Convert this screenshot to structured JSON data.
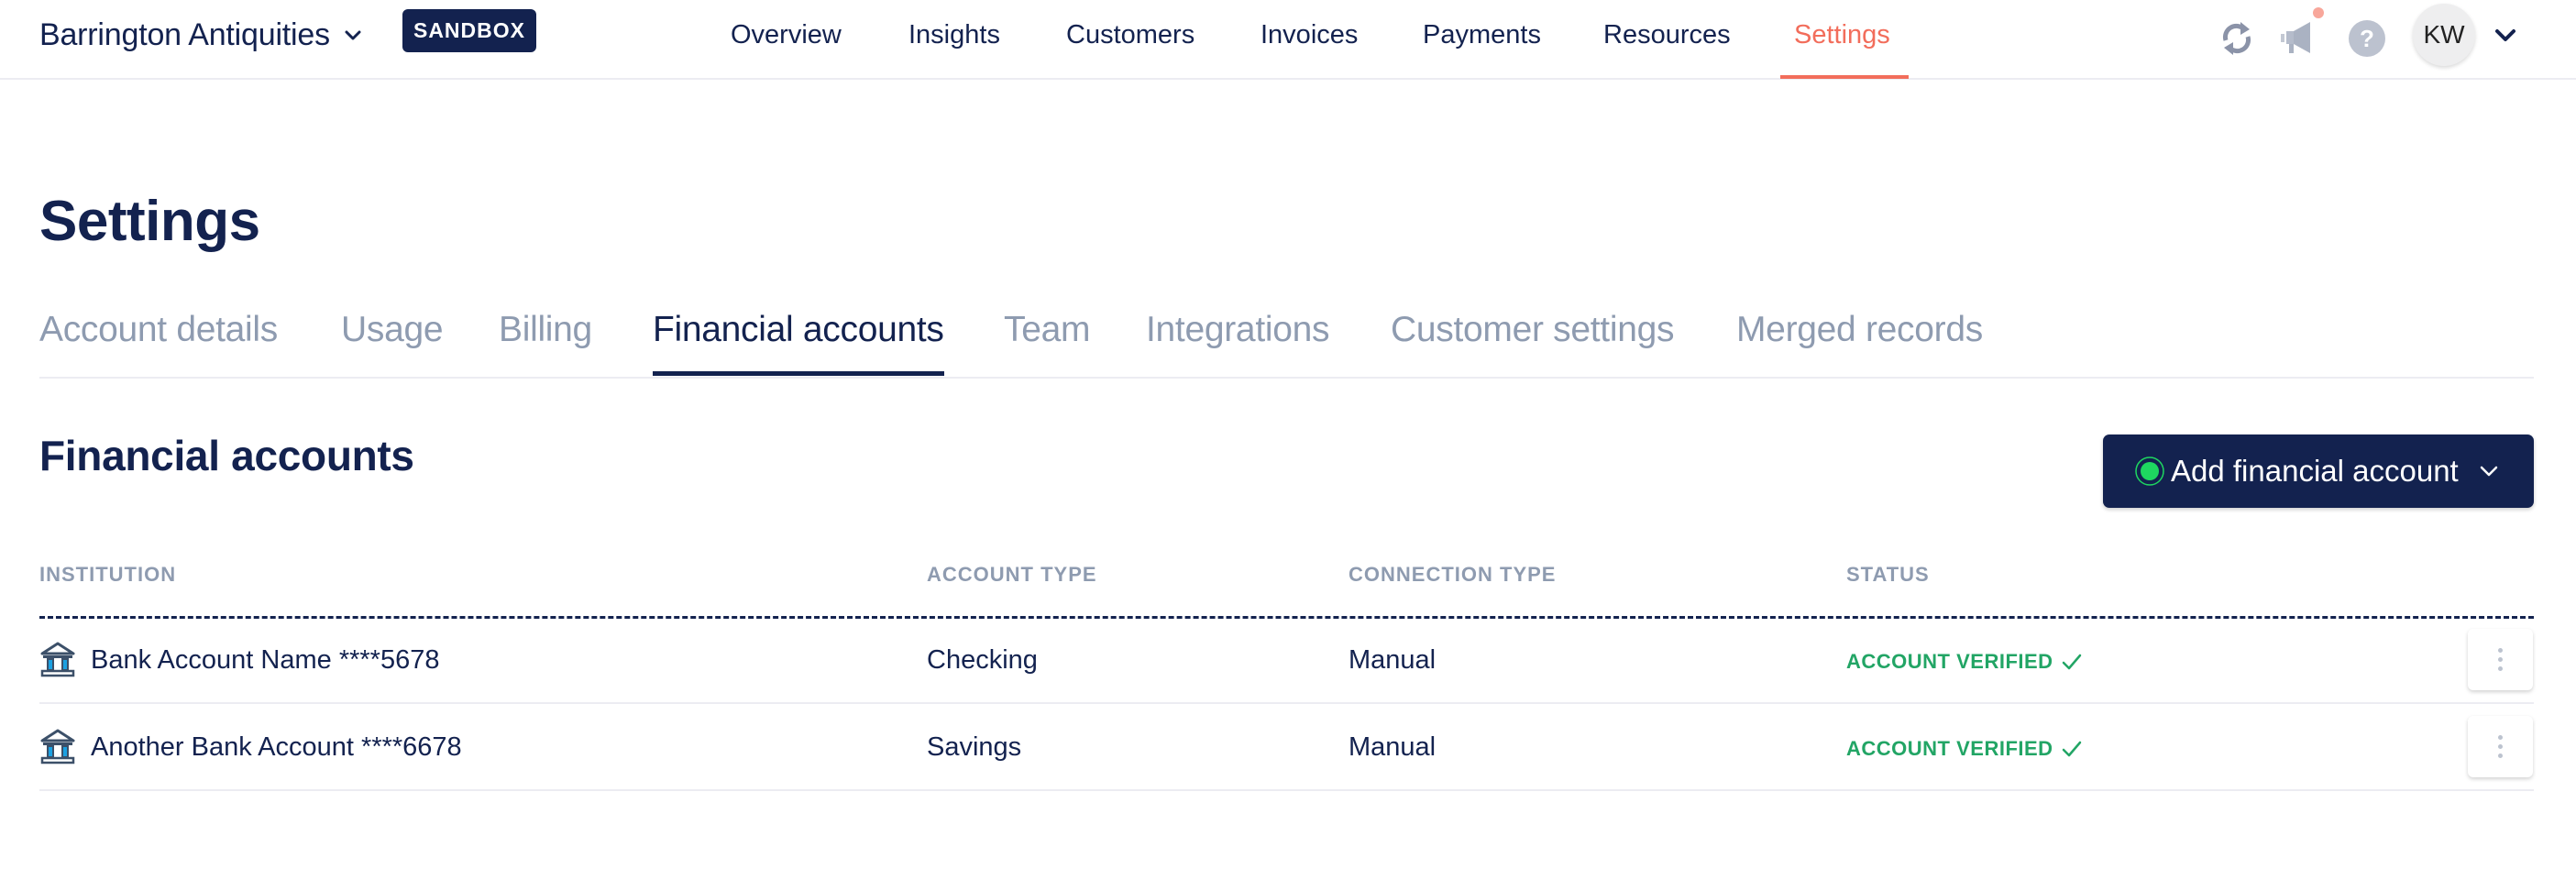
{
  "header": {
    "brand": "Barrington Antiquities",
    "environment_badge": "SANDBOX",
    "nav": [
      {
        "label": "Overview",
        "active": false
      },
      {
        "label": "Insights",
        "active": false
      },
      {
        "label": "Customers",
        "active": false
      },
      {
        "label": "Invoices",
        "active": false
      },
      {
        "label": "Payments",
        "active": false
      },
      {
        "label": "Resources",
        "active": false
      },
      {
        "label": "Settings",
        "active": true
      }
    ],
    "icons": [
      "refresh-icon",
      "announcements-icon",
      "help-icon"
    ],
    "has_notification": true,
    "avatar_initials": "KW"
  },
  "page": {
    "title": "Settings",
    "tabs": [
      {
        "label": "Account details",
        "active": false
      },
      {
        "label": "Usage",
        "active": false
      },
      {
        "label": "Billing",
        "active": false
      },
      {
        "label": "Financial accounts",
        "active": true
      },
      {
        "label": "Team",
        "active": false
      },
      {
        "label": "Integrations",
        "active": false
      },
      {
        "label": "Customer settings",
        "active": false
      },
      {
        "label": "Merged records",
        "active": false
      }
    ]
  },
  "financial_accounts": {
    "title": "Financial accounts",
    "add_button_label": "Add financial account",
    "columns": [
      "INSTITUTION",
      "ACCOUNT TYPE",
      "CONNECTION TYPE",
      "STATUS"
    ],
    "rows": [
      {
        "institution": "Bank Account Name ****5678",
        "account_type": "Checking",
        "connection_type": "Manual",
        "status": "ACCOUNT VERIFIED"
      },
      {
        "institution": "Another Bank Account ****6678",
        "account_type": "Savings",
        "connection_type": "Manual",
        "status": "ACCOUNT VERIFIED"
      }
    ]
  },
  "colors": {
    "primary": "#13224f",
    "accent": "#f26d5b",
    "muted": "#8e9bb0",
    "success": "#22a565",
    "indicator": "#1ed760"
  }
}
